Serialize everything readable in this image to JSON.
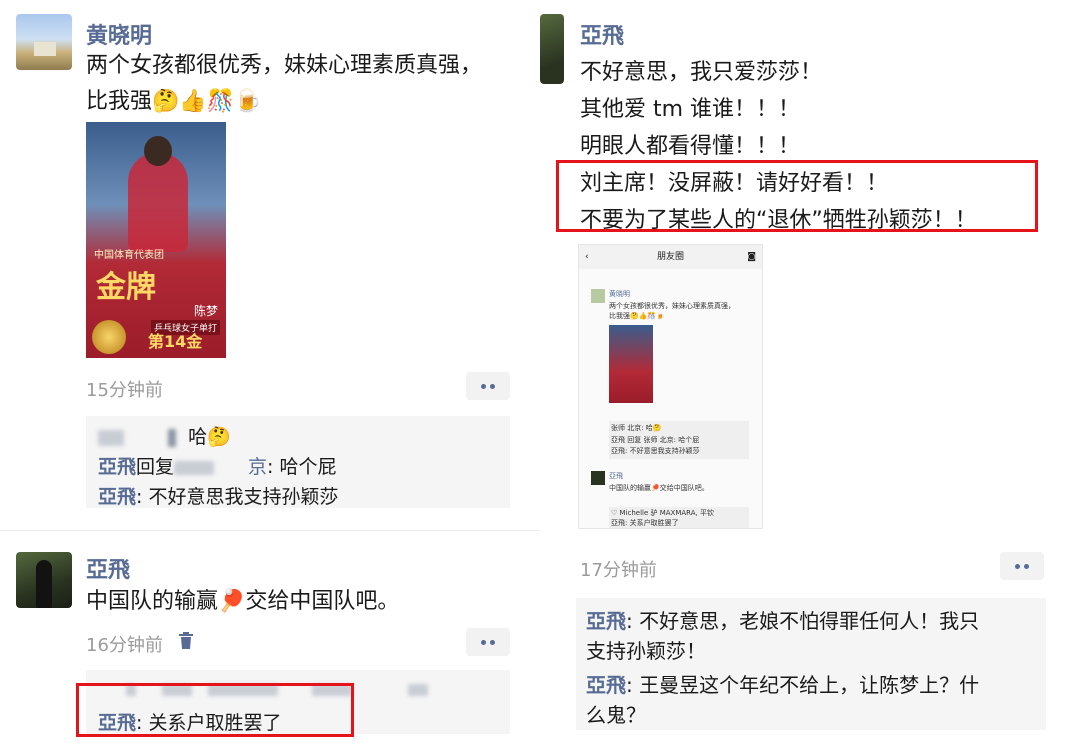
{
  "left": {
    "post1": {
      "author": "黄晓明",
      "text_line1": "两个女孩都很优秀，妹妹心理素质真强，",
      "text_line2": "比我强",
      "emojis": "🤔👍🎊🍺",
      "poster": {
        "title_line1": "中国体育代表团",
        "title_line2": "中国体育代表团",
        "gold": "金牌",
        "athlete": "陈梦",
        "event": "乒乓球女子单打",
        "count": "第14金"
      },
      "time": "15分钟前",
      "comments": {
        "line1_suffix": "哈🤔",
        "line2_name": "亞飛",
        "line2_reply": "回复",
        "line2_mid": "京",
        "line2_text": ": 哈个屁",
        "line3_name": "亞飛",
        "line3_text": ": 不好意思我支持孙颖莎"
      }
    },
    "post2": {
      "author": "亞飛",
      "text": "中国队的输赢🏓交给中国队吧。",
      "time": "16分钟前",
      "comment_name": "亞飛",
      "comment_text": ": 关系户取胜罢了"
    }
  },
  "right": {
    "author": "亞飛",
    "lines": [
      "不好意思，我只爱莎莎！",
      "其他爱 tm 谁谁！！！",
      "明眼人都看得懂！！！",
      "刘主席！没屏蔽！请好好看！！",
      "不要为了某些人的“退休”牺牲孙颖莎！！"
    ],
    "mini": {
      "title": "朋友圈",
      "author1": "黄晓明",
      "text1a": "两个女孩都很优秀，妹妹心理素质真强，",
      "text1b": "比我强🤔👍🎊🍺",
      "c1": "张师 北京: 哈🤔",
      "c2": "亞飛 回复 张师 北京: 哈个屁",
      "c3": "亞飛: 不好意思我支持孙颖莎",
      "author2": "亞飛",
      "text2": "中国队的输赢🏓交给中国队吧。",
      "c4": "♡ Michelle 驴 MAXMARA, 平钦",
      "c5": "亞飛: 关系户取胜罢了"
    },
    "time": "17分钟前",
    "comment1_name": "亞飛",
    "comment1_text_a": ": 不好意思，老娘不怕得罪任何人！我只",
    "comment1_text_b": "支持孙颖莎！",
    "comment2_name": "亞飛",
    "comment2_text_a": ": 王曼昱这个年纪不给上，让陈梦上？什",
    "comment2_text_b": "么鬼？"
  }
}
